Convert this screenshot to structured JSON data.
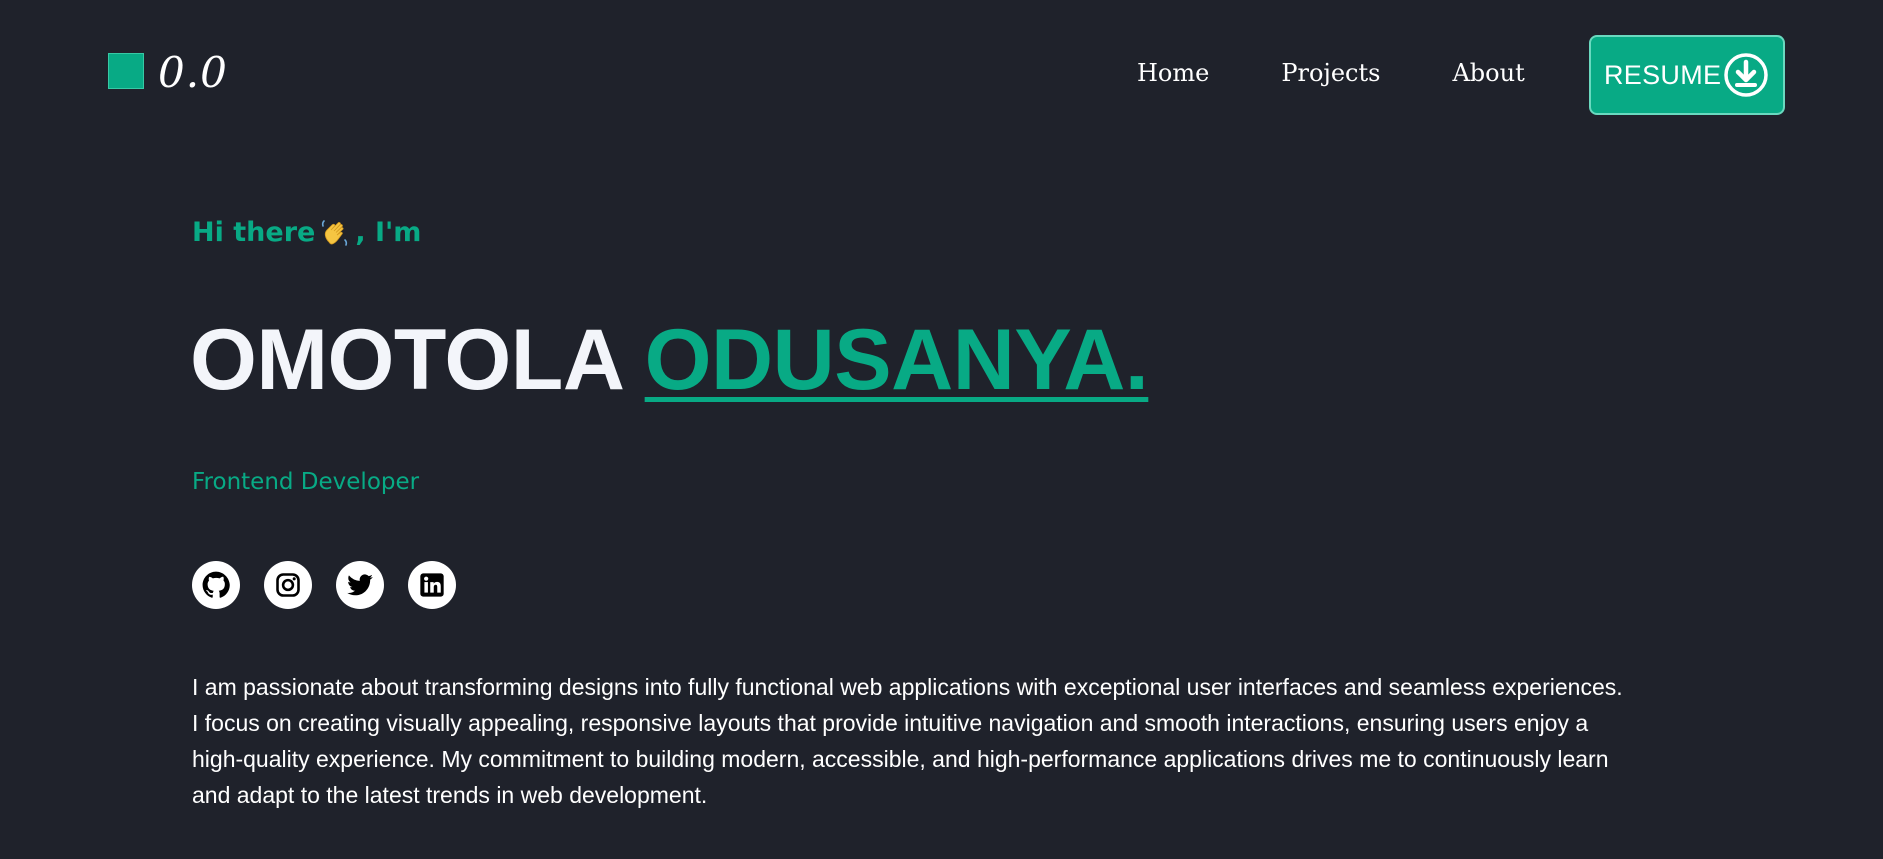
{
  "header": {
    "logo_text": "0.0",
    "nav": [
      {
        "label": "Home"
      },
      {
        "label": "Projects"
      },
      {
        "label": "About"
      }
    ],
    "resume_label": "RESUME"
  },
  "hero": {
    "greeting_before": "Hi there",
    "greeting_after": ", I'm",
    "first_name": "OMOTOLA",
    "last_name": "ODUSANYA.",
    "role": "Frontend Developer",
    "bio_lines": [
      "I am passionate about transforming designs into fully functional web applications with exceptional user interfaces and seamless experiences.",
      "I focus on creating visually appealing, responsive layouts that provide intuitive navigation and smooth interactions, ensuring users enjoy a",
      "high-quality experience. My commitment to building modern, accessible, and high-performance applications drives me to continuously learn",
      "and adapt to the latest trends in web development."
    ]
  },
  "socials": [
    {
      "icon": "github-icon"
    },
    {
      "icon": "instagram-icon"
    },
    {
      "icon": "twitter-icon"
    },
    {
      "icon": "linkedin-icon"
    }
  ],
  "colors": {
    "background": "#1f222b",
    "accent": "#08aa85",
    "text": "#ffffff"
  }
}
